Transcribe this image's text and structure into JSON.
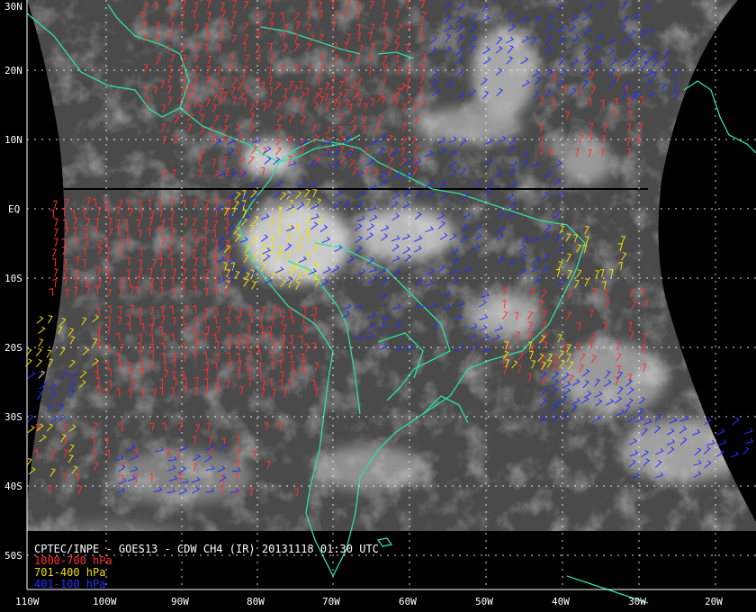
{
  "title_line": "CPTEC/INPE - GOES13 - CDW CH4 (IR) 20131118 01:30 UTC",
  "legend": [
    {
      "label": "1000-700 hPa",
      "color": "#ff3030"
    },
    {
      "label": "701-400 hPa",
      "color": "#f0e000"
    },
    {
      "label": "401-100 hPa",
      "color": "#2030ff"
    }
  ],
  "lat_labels": [
    "30N",
    "20N",
    "10N",
    "EQ",
    "10S",
    "20S",
    "30S",
    "40S",
    "50S"
  ],
  "lon_labels": [
    "110W",
    "100W",
    "90W",
    "80W",
    "70W",
    "60W",
    "50W",
    "40W",
    "30W",
    "20W"
  ],
  "colors": {
    "background": "#000000",
    "coastline": "#30e0a0",
    "grid": "#ffffff",
    "text": "#ffffff"
  }
}
